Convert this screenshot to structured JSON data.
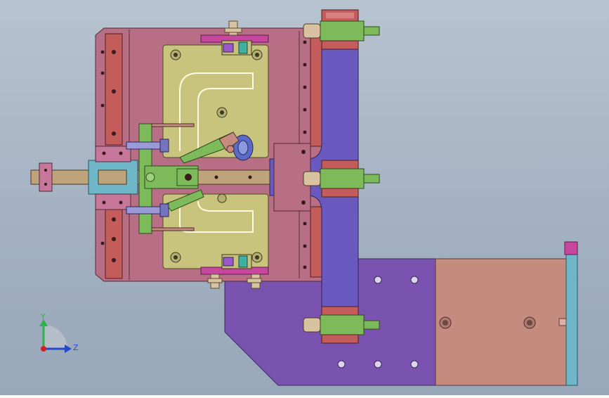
{
  "triad": {
    "y_label": "Y",
    "z_label": "Z",
    "y_color": "#2fb24a",
    "z_color": "#2747c8",
    "x_color": "#d22020"
  },
  "colors": {
    "background_top": "#b8c3d0",
    "background_bottom": "#98a7b9",
    "base_plate": "#b86f86",
    "rail": "#c45c5c",
    "cam_plate": "#c8c47e",
    "slider_bar": "#bfa37a",
    "green_part": "#7dbb5a",
    "blue_arm": "#6a5ac0",
    "purple_plate": "#7a52b0",
    "salmon_block": "#c58b7e",
    "cyan_strip": "#6fb7c8",
    "magenta_plate": "#c7479e"
  }
}
